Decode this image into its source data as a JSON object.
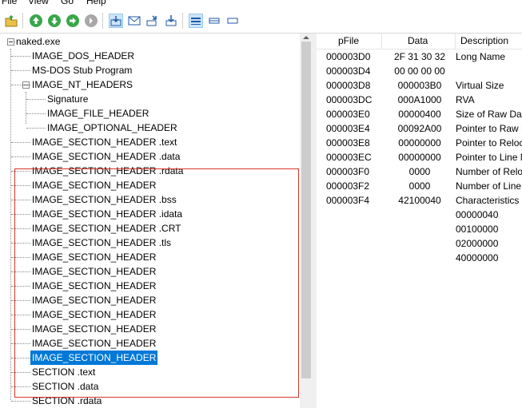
{
  "menu": [
    "File",
    "View",
    "Go",
    "Help"
  ],
  "toolbar": {
    "buttons": [
      "open-folder-icon",
      "go-up-icon",
      "go-down-icon",
      "go-forward-icon",
      "go-back-icon",
      "save-icon",
      "mail-icon",
      "export-icon",
      "import-icon",
      "view-details-icon",
      "view-list-icon",
      "view-small-icon"
    ],
    "accent": "#0078d7"
  },
  "tree": {
    "root": "naked.exe",
    "items": [
      "IMAGE_DOS_HEADER",
      "MS-DOS Stub Program",
      "IMAGE_NT_HEADERS",
      "Signature",
      "IMAGE_FILE_HEADER",
      "IMAGE_OPTIONAL_HEADER",
      "IMAGE_SECTION_HEADER .text",
      "IMAGE_SECTION_HEADER .data",
      "IMAGE_SECTION_HEADER .rdata",
      "IMAGE_SECTION_HEADER",
      "IMAGE_SECTION_HEADER .bss",
      "IMAGE_SECTION_HEADER .idata",
      "IMAGE_SECTION_HEADER .CRT",
      "IMAGE_SECTION_HEADER .tls",
      "IMAGE_SECTION_HEADER",
      "IMAGE_SECTION_HEADER",
      "IMAGE_SECTION_HEADER",
      "IMAGE_SECTION_HEADER",
      "IMAGE_SECTION_HEADER",
      "IMAGE_SECTION_HEADER",
      "IMAGE_SECTION_HEADER",
      "IMAGE_SECTION_HEADER",
      "SECTION .text",
      "SECTION .data",
      "SECTION .rdata"
    ],
    "selected_index": 21,
    "highlight_color": "#d9342b"
  },
  "list": {
    "columns": [
      "pFile",
      "Data",
      "Description"
    ],
    "rows": [
      [
        "000003D0",
        "2F  31  30  32",
        "Long Name"
      ],
      [
        "000003D4",
        "00  00  00  00",
        ""
      ],
      [
        "000003D8",
        "000003B0",
        "Virtual Size"
      ],
      [
        "000003DC",
        "000A1000",
        "RVA"
      ],
      [
        "000003E0",
        "00000400",
        "Size of Raw Data"
      ],
      [
        "000003E4",
        "00092A00",
        "Pointer to Raw Data"
      ],
      [
        "000003E8",
        "00000000",
        "Pointer to Relocations"
      ],
      [
        "000003EC",
        "00000000",
        "Pointer to Line Numbers"
      ],
      [
        "000003F0",
        "0000",
        "Number of Relocations"
      ],
      [
        "000003F2",
        "0000",
        "Number of Line Numbers"
      ],
      [
        "000003F4",
        "42100040",
        "Characteristics"
      ],
      [
        "",
        "",
        "00000040"
      ],
      [
        "",
        "",
        "00100000"
      ],
      [
        "",
        "",
        "02000000"
      ],
      [
        "",
        "",
        "40000000"
      ]
    ]
  }
}
